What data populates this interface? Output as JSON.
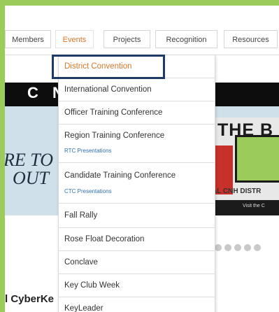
{
  "nav": {
    "items": [
      {
        "label": "Members"
      },
      {
        "label": "Events",
        "active": true
      },
      {
        "label": "Projects"
      },
      {
        "label": "Recognition"
      },
      {
        "label": "Resources"
      }
    ]
  },
  "banner": {
    "strip_text": "C N",
    "left_text": "RE TO\n  OUT",
    "right_title": "THE B",
    "right_caption": "AL CNH DISTR",
    "right_bar_text": "Visit the C"
  },
  "dropdown": {
    "items": [
      {
        "label": "District Convention",
        "active": true
      },
      {
        "label": "International Convention"
      },
      {
        "label": "Officer Training Conference"
      },
      {
        "label": "Region Training Conference",
        "sub": "RTC Presentations"
      },
      {
        "label": "Candidate Training Conference",
        "sub": "CTC Presentations"
      },
      {
        "label": "Fall Rally"
      },
      {
        "label": "Rose Float Decoration"
      },
      {
        "label": "Conclave"
      },
      {
        "label": "Key Club Week"
      },
      {
        "label": "KeyLeader"
      }
    ]
  },
  "section": {
    "heading": "l CyberKe"
  },
  "colors": {
    "accent_green": "#9bcb5b",
    "active_orange": "#d9772a",
    "highlight_navy": "#1d3a6b",
    "sub_link_blue": "#2f6fb0"
  }
}
